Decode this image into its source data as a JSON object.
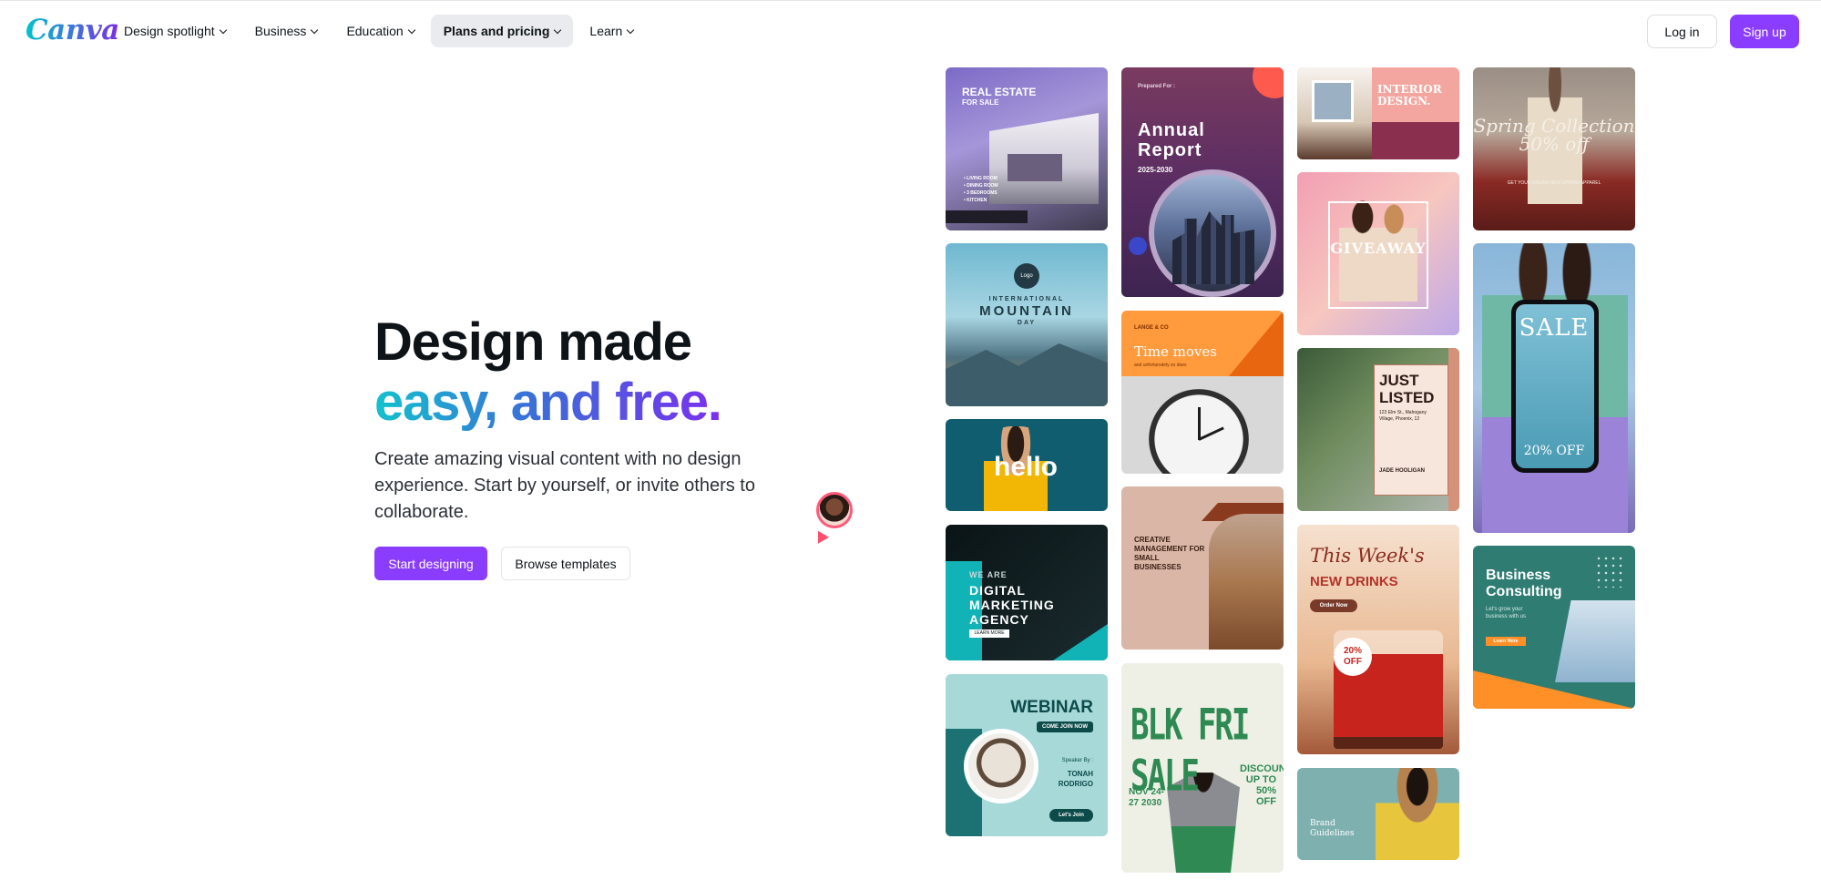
{
  "colors": {
    "brand": "#8b3dff",
    "text": "#0e1318"
  },
  "header": {
    "logo": "Canva",
    "nav": [
      {
        "label": "Design spotlight",
        "active": false
      },
      {
        "label": "Business",
        "active": false
      },
      {
        "label": "Education",
        "active": false
      },
      {
        "label": "Plans and pricing",
        "active": true
      },
      {
        "label": "Learn",
        "active": false
      }
    ],
    "login_label": "Log in",
    "signup_label": "Sign up"
  },
  "hero": {
    "title_line1": "Design made",
    "title_line2": "easy, and free.",
    "subtitle": "Create amazing visual content with no design experience. Start by yourself, or invite others to collaborate.",
    "primary_button": "Start designing",
    "secondary_button": "Browse templates"
  },
  "templates": {
    "real_estate": {
      "title": "REAL ESTATE",
      "subtitle": "FOR SALE",
      "features": [
        "• LIVING ROOM",
        "• DINING ROOM",
        "• 3 BEDROOMS",
        "• KITCHEN"
      ]
    },
    "mountain": {
      "badge": "Logo",
      "line1": "INTERNATIONAL",
      "line2": "MOUNTAIN",
      "line3": "DAY"
    },
    "hello": {
      "title": "hello"
    },
    "digital": {
      "pre": "WE ARE",
      "title": "DIGITAL MARKETING AGENCY",
      "button": "LEARN MORE"
    },
    "webinar": {
      "title": "WEBINAR",
      "pill": "COME JOIN NOW",
      "speaker_label": "Speaker By :",
      "speaker_name": "TONAH RODRIGO",
      "join": "Let's Join"
    },
    "annual": {
      "prepared": "Prepared For :",
      "title": "Annual Report",
      "years": "2025-2030"
    },
    "time": {
      "brand": "LANGE & CO",
      "title": "Time moves",
      "tagline": "and unfortunately so does"
    },
    "creative": {
      "title": "CREATIVE MANAGEMENT FOR SMALL BUSINESSES"
    },
    "blkfri": {
      "title": "BLK FRI SALE",
      "discount": "DISCOUNT UP TO 50% OFF",
      "date": "NOV 24-27 2030"
    },
    "interior": {
      "title": "INTERIOR DESIGN."
    },
    "giveaway": {
      "title": "GIVEAWAY"
    },
    "listed": {
      "title": "JUST LISTED",
      "address": "123 Elm St., Mahogany Village, Phoenix, 12",
      "agent": "JADE HOOLIGAN"
    },
    "drinks": {
      "title": "This Week's",
      "subtitle": "NEW DRINKS",
      "pill": "Order Now",
      "badge": "20% OFF"
    },
    "brand": {
      "title": "Brand Guidelines"
    },
    "spring": {
      "title": "Spring Collection 50% off",
      "sub": "GET YOUR DREAM NEW SPRING APPAREL"
    },
    "sale": {
      "title": "SALE",
      "off": "20% OFF"
    },
    "consulting": {
      "title": "Business Consulting",
      "body": "Let's grow your business with us",
      "button": "Learn More"
    }
  }
}
